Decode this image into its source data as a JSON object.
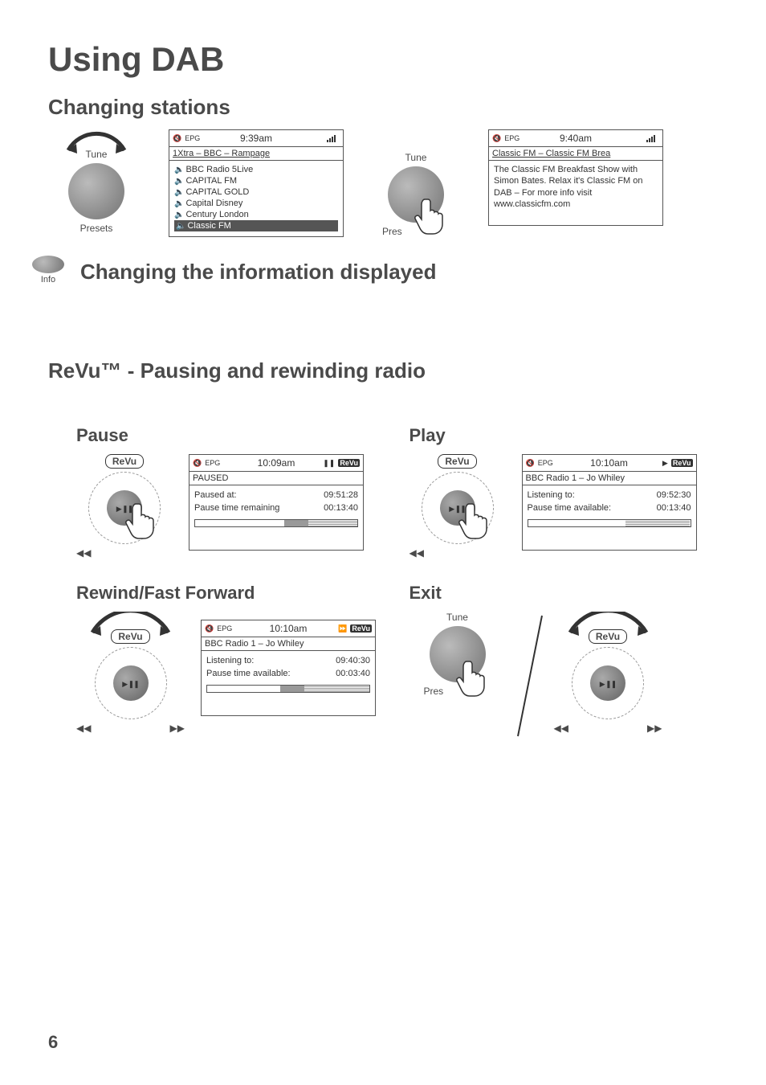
{
  "page_number": "6",
  "h1": "Using DAB",
  "h2_a": "Changing stations",
  "h2_b": "Changing the information displayed",
  "h2_c": "ReVu™ - Pausing and rewinding radio",
  "knob": {
    "tune": "Tune",
    "presets": "Presets"
  },
  "info": {
    "label": "Info"
  },
  "lcd1": {
    "time": "9:39am",
    "sub": "1Xtra – BBC – Rampage",
    "items": [
      "BBC Radio 5Live",
      "CAPITAL FM",
      "CAPITAL GOLD",
      "Capital Disney",
      "Century London",
      "Classic FM"
    ]
  },
  "lcd2": {
    "time": "9:40am",
    "sub": "Classic FM – Classic FM Brea",
    "text": "The Classic FM Breakfast Show with Simon Bates.  Relax it's Classic FM on DAB – For more info visit www.classicfm.com"
  },
  "revu_label": "ReVu",
  "pause": {
    "title": "Pause",
    "time": "10:09am",
    "sub": "PAUSED",
    "k1": "Paused at:",
    "v1": "09:51:28",
    "k2": "Pause time remaining",
    "v2": "00:13:40",
    "badge": "ReVu"
  },
  "play": {
    "title": "Play",
    "time": "10:10am",
    "sub": "BBC Radio 1 – Jo Whiley",
    "k1": "Listening to:",
    "v1": "09:52:30",
    "k2": "Pause time available:",
    "v2": "00:13:40",
    "badge": "ReVu"
  },
  "rwff": {
    "title": "Rewind/Fast Forward",
    "time": "10:10am",
    "sub": "BBC Radio 1 – Jo Whiley",
    "k1": "Listening to:",
    "v1": "09:40:30",
    "k2": "Pause time available:",
    "v2": "00:03:40",
    "badge": "ReVu"
  },
  "exit": {
    "title": "Exit"
  },
  "icons": {
    "rewind": "◀◀",
    "ffwd": "▶▶",
    "play_badge_left": "▶",
    "pause_badge_left": "❚❚"
  }
}
